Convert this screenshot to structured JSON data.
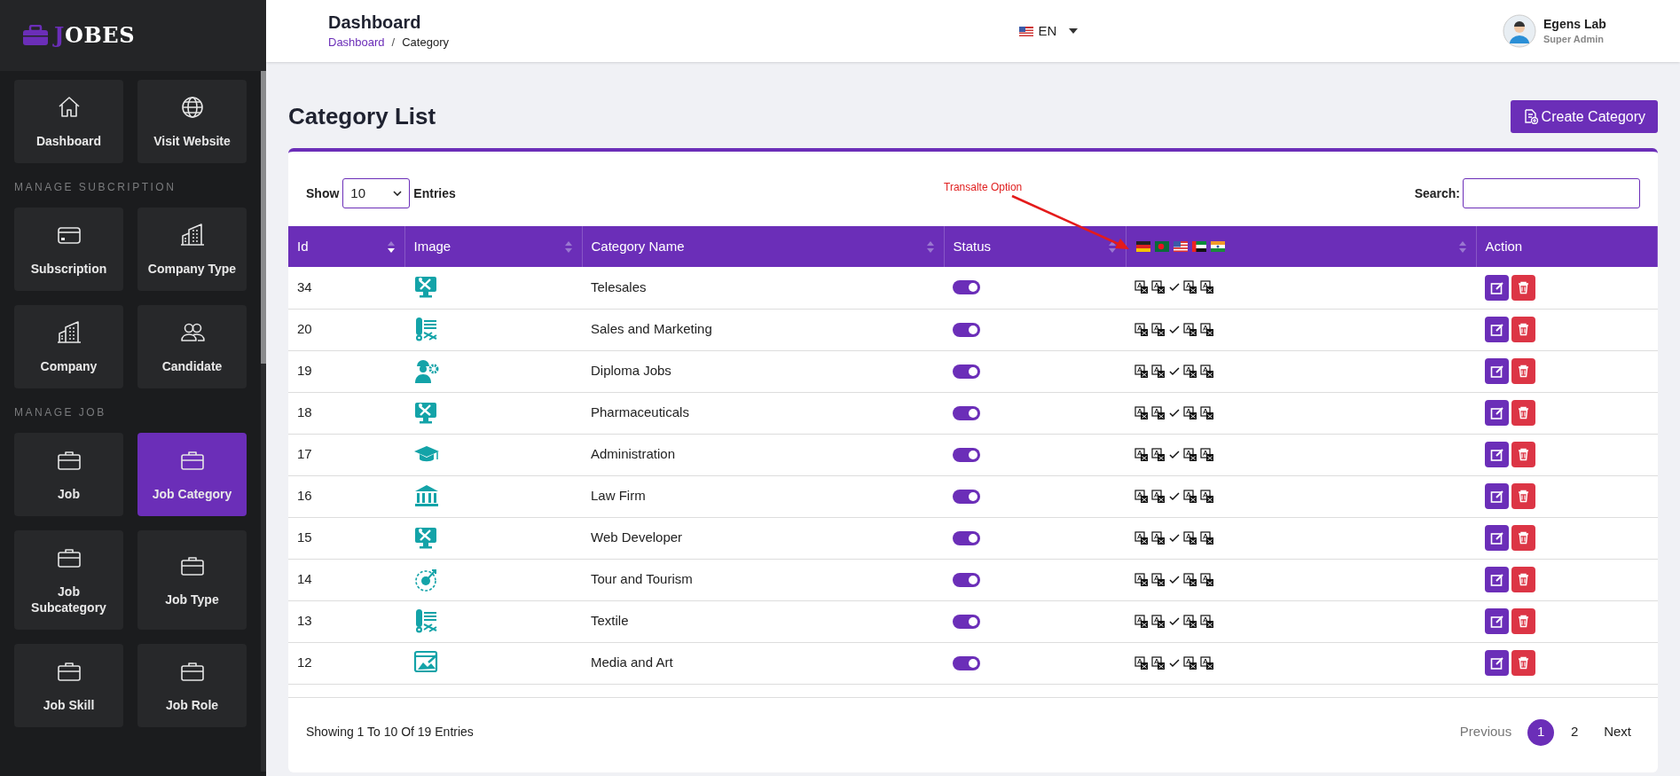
{
  "logo": {
    "first": "J",
    "rest": "OBES"
  },
  "sidebar": {
    "sections": [
      {
        "items": [
          {
            "label": "Dashboard",
            "kind": "house",
            "selected": false
          },
          {
            "label": "Visit Website",
            "kind": "globe",
            "selected": false
          }
        ]
      },
      {
        "label": "MANAGE SUBCRIPTION",
        "items": [
          {
            "label": "Subscription",
            "kind": "card",
            "selected": false
          },
          {
            "label": "Company Type",
            "kind": "building",
            "selected": false
          },
          {
            "label": "Company",
            "kind": "building",
            "selected": false
          },
          {
            "label": "Candidate",
            "kind": "people",
            "selected": false
          }
        ]
      },
      {
        "label": "MANAGE JOB",
        "items": [
          {
            "label": "Job",
            "kind": "briefcase",
            "selected": false
          },
          {
            "label": "Job Category",
            "kind": "briefcase",
            "selected": true
          },
          {
            "label": "Job Subcategory",
            "kind": "briefcase",
            "selected": false
          },
          {
            "label": "Job Type",
            "kind": "briefcase",
            "selected": false
          },
          {
            "label": "Job Skill",
            "kind": "briefcase",
            "selected": false
          },
          {
            "label": "Job Role",
            "kind": "briefcase",
            "selected": false
          }
        ]
      }
    ]
  },
  "header": {
    "title": "Dashboard",
    "breadcrumb": [
      "Dashboard",
      "Category"
    ],
    "breadcrumb_separator": "/",
    "language": "EN",
    "user": {
      "name": "Egens Lab",
      "role": "Super Admin"
    }
  },
  "page": {
    "title": "Category List",
    "create_button": "Create Category"
  },
  "table_controls": {
    "show": "Show",
    "entries_value": "10",
    "entries": "Entries",
    "search_label": "Search:"
  },
  "annotation": {
    "text": "Transalte Option"
  },
  "table": {
    "columns": [
      {
        "kind": "text",
        "label": "Id",
        "sortable": true,
        "sorted": true
      },
      {
        "kind": "text",
        "label": "Image",
        "sortable": true,
        "sorted": false
      },
      {
        "kind": "text",
        "label": "Category Name",
        "sortable": true,
        "sorted": false
      },
      {
        "kind": "text",
        "label": "Status",
        "sortable": true,
        "sorted": false
      },
      {
        "kind": "flags",
        "sortable": true,
        "sorted": false
      },
      {
        "kind": "text",
        "label": "Action",
        "sortable": false
      }
    ],
    "rows": [
      {
        "id": "34",
        "kind": "monitor",
        "name": "Telesales",
        "on": true,
        "translations": [
          {
            "done": false
          },
          {
            "done": false
          },
          {
            "done": true
          },
          {
            "done": false
          },
          {
            "done": false
          }
        ]
      },
      {
        "id": "20",
        "kind": "fabric",
        "name": "Sales and Marketing",
        "on": true,
        "translations": [
          {
            "done": false
          },
          {
            "done": false
          },
          {
            "done": true
          },
          {
            "done": false
          },
          {
            "done": false
          }
        ]
      },
      {
        "id": "19",
        "kind": "engineer",
        "name": "Diploma Jobs",
        "on": true,
        "translations": [
          {
            "done": false
          },
          {
            "done": false
          },
          {
            "done": true
          },
          {
            "done": false
          },
          {
            "done": false
          }
        ]
      },
      {
        "id": "18",
        "kind": "monitor",
        "name": "Pharmaceuticals",
        "on": true,
        "translations": [
          {
            "done": false
          },
          {
            "done": false
          },
          {
            "done": true
          },
          {
            "done": false
          },
          {
            "done": false
          }
        ]
      },
      {
        "id": "17",
        "kind": "cap",
        "name": "Administration",
        "on": true,
        "translations": [
          {
            "done": false
          },
          {
            "done": false
          },
          {
            "done": true
          },
          {
            "done": false
          },
          {
            "done": false
          }
        ]
      },
      {
        "id": "16",
        "kind": "bank",
        "name": "Law Firm",
        "on": true,
        "translations": [
          {
            "done": false
          },
          {
            "done": false
          },
          {
            "done": true
          },
          {
            "done": false
          },
          {
            "done": false
          }
        ]
      },
      {
        "id": "15",
        "kind": "monitor",
        "name": "Web Developer",
        "on": true,
        "translations": [
          {
            "done": false
          },
          {
            "done": false
          },
          {
            "done": true
          },
          {
            "done": false
          },
          {
            "done": false
          }
        ]
      },
      {
        "id": "14",
        "kind": "target",
        "name": "Tour and Tourism",
        "on": true,
        "translations": [
          {
            "done": false
          },
          {
            "done": false
          },
          {
            "done": true
          },
          {
            "done": false
          },
          {
            "done": false
          }
        ]
      },
      {
        "id": "13",
        "kind": "fabric",
        "name": "Textile",
        "on": true,
        "translations": [
          {
            "done": false
          },
          {
            "done": false
          },
          {
            "done": true
          },
          {
            "done": false
          },
          {
            "done": false
          }
        ]
      },
      {
        "id": "12",
        "kind": "gallery",
        "name": "Media and Art",
        "on": true,
        "translations": [
          {
            "done": false
          },
          {
            "done": false
          },
          {
            "done": true
          },
          {
            "done": false
          },
          {
            "done": false
          }
        ]
      }
    ]
  },
  "footer": {
    "info": "Showing 1 To 10 Of 19 Entries",
    "pages": [
      {
        "label": "Previous",
        "kind": "nav",
        "selected": false
      },
      {
        "label": "1",
        "kind": "page",
        "selected": true
      },
      {
        "label": "2",
        "kind": "page",
        "selected": false
      },
      {
        "label": "Next",
        "kind": "nav",
        "selected": false
      }
    ]
  }
}
